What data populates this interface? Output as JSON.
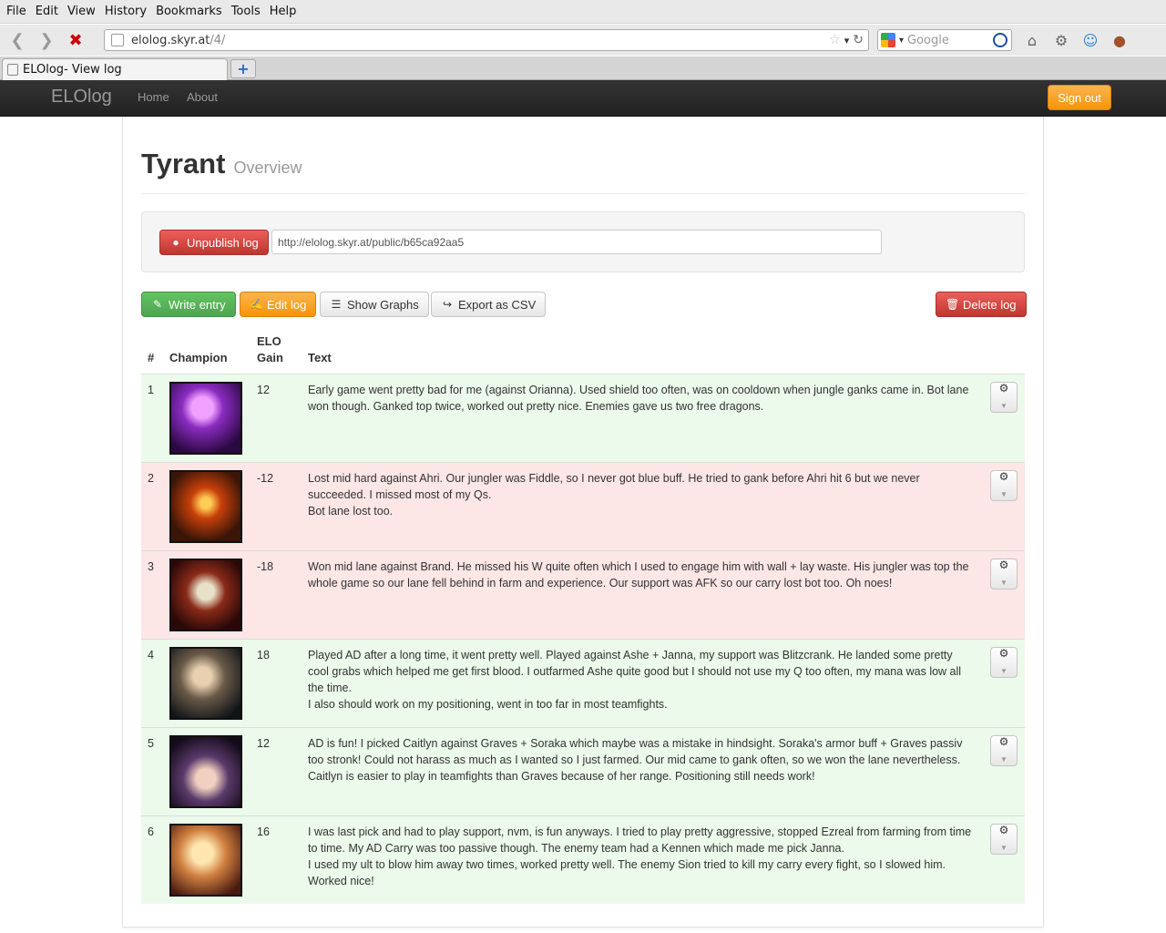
{
  "browser": {
    "menu": [
      "File",
      "Edit",
      "View",
      "History",
      "Bookmarks",
      "Tools",
      "Help"
    ],
    "url_host": "elolog.skyr.at",
    "url_path": "/4/",
    "search_placeholder": "Google",
    "tab_title": "ELOlog- View log",
    "new_tab": "+"
  },
  "site": {
    "brand": "ELOlog",
    "nav": [
      "Home",
      "About"
    ],
    "signout": "Sign out"
  },
  "page": {
    "title": "Tyrant",
    "subtitle": "Overview",
    "unpublish": "Unpublish log",
    "public_url": "http://elolog.skyr.at/public/b65ca92aa5",
    "write_entry": "Write entry",
    "edit_log": "Edit log",
    "show_graphs": "Show Graphs",
    "export_csv": "Export as CSV",
    "delete_log": "Delete log"
  },
  "table": {
    "headers": [
      "#",
      "Champion",
      "ELO Gain",
      "Text"
    ],
    "rows": [
      {
        "num": "1",
        "gain": "12",
        "outcome": "win",
        "champion_image": "purple-haired champion portrait",
        "text": [
          "Early game went pretty bad for me (against Orianna). Used shield too often, was on cooldown when jungle ganks came in. Bot lane won though. Ganked top twice, worked out pretty nice. Enemies gave us two free dragons."
        ]
      },
      {
        "num": "2",
        "gain": "-12",
        "outcome": "loss",
        "champion_image": "molten armored champion portrait",
        "text": [
          "Lost mid hard against Ahri. Our jungler was Fiddle, so I never got blue buff. He tried to gank before Ahri hit 6 but we never succeeded. I missed most of my Qs.",
          "Bot lane lost too."
        ]
      },
      {
        "num": "3",
        "gain": "-18",
        "outcome": "loss",
        "champion_image": "skull-faced champion portrait",
        "text": [
          "Won mid lane against Brand. He missed his W quite often which I used to engage him with wall + lay waste. His jungler was top the whole game so our lane fell behind in farm and experience. Our support was AFK so our carry lost bot too. Oh noes!"
        ]
      },
      {
        "num": "4",
        "gain": "18",
        "outcome": "win",
        "champion_image": "bearded gunslinger champion portrait",
        "text": [
          "Played AD after a long time, it went pretty well. Played against Ashe + Janna, my support was Blitzcrank. He landed some pretty cool grabs which helped me get first blood. I outfarmed Ashe quite good but I should not use my Q too often, my mana was low all the time.",
          "I also should work on my positioning, went in too far in most teamfights."
        ]
      },
      {
        "num": "5",
        "gain": "12",
        "outcome": "win",
        "champion_image": "hat-wearing sheriff champion portrait",
        "text": [
          "AD is fun! I picked Caitlyn against Graves + Soraka which maybe was a mistake in hindsight. Soraka's armor buff + Graves passiv too stronk! Could not harass as much as I wanted so I just farmed. Our mid came to gank often, so we won the lane nevertheless. Caitlyn is easier to play in teamfights than Graves because of her range. Positioning still needs work!"
        ]
      },
      {
        "num": "6",
        "gain": "16",
        "outcome": "win",
        "champion_image": "blonde champion portrait",
        "text": [
          "I was last pick and had to play support, nvm, is fun anyways. I tried to play pretty aggressive, stopped Ezreal from farming from time to time. My AD Carry was too passive though. The enemy team had a Kennen which made me pick Janna.",
          "I used my ult to blow him away two times, worked pretty well. The enemy Sion tried to kill my carry every fight, so I slowed him. Worked nice!"
        ]
      }
    ]
  },
  "colors": {
    "win_row": "#ebfaea",
    "loss_row": "#fce6e6",
    "gain_positive": "#5bb75b",
    "gain_negative": "#da4f49",
    "navbar": "#222222",
    "orange": "#f89406"
  }
}
